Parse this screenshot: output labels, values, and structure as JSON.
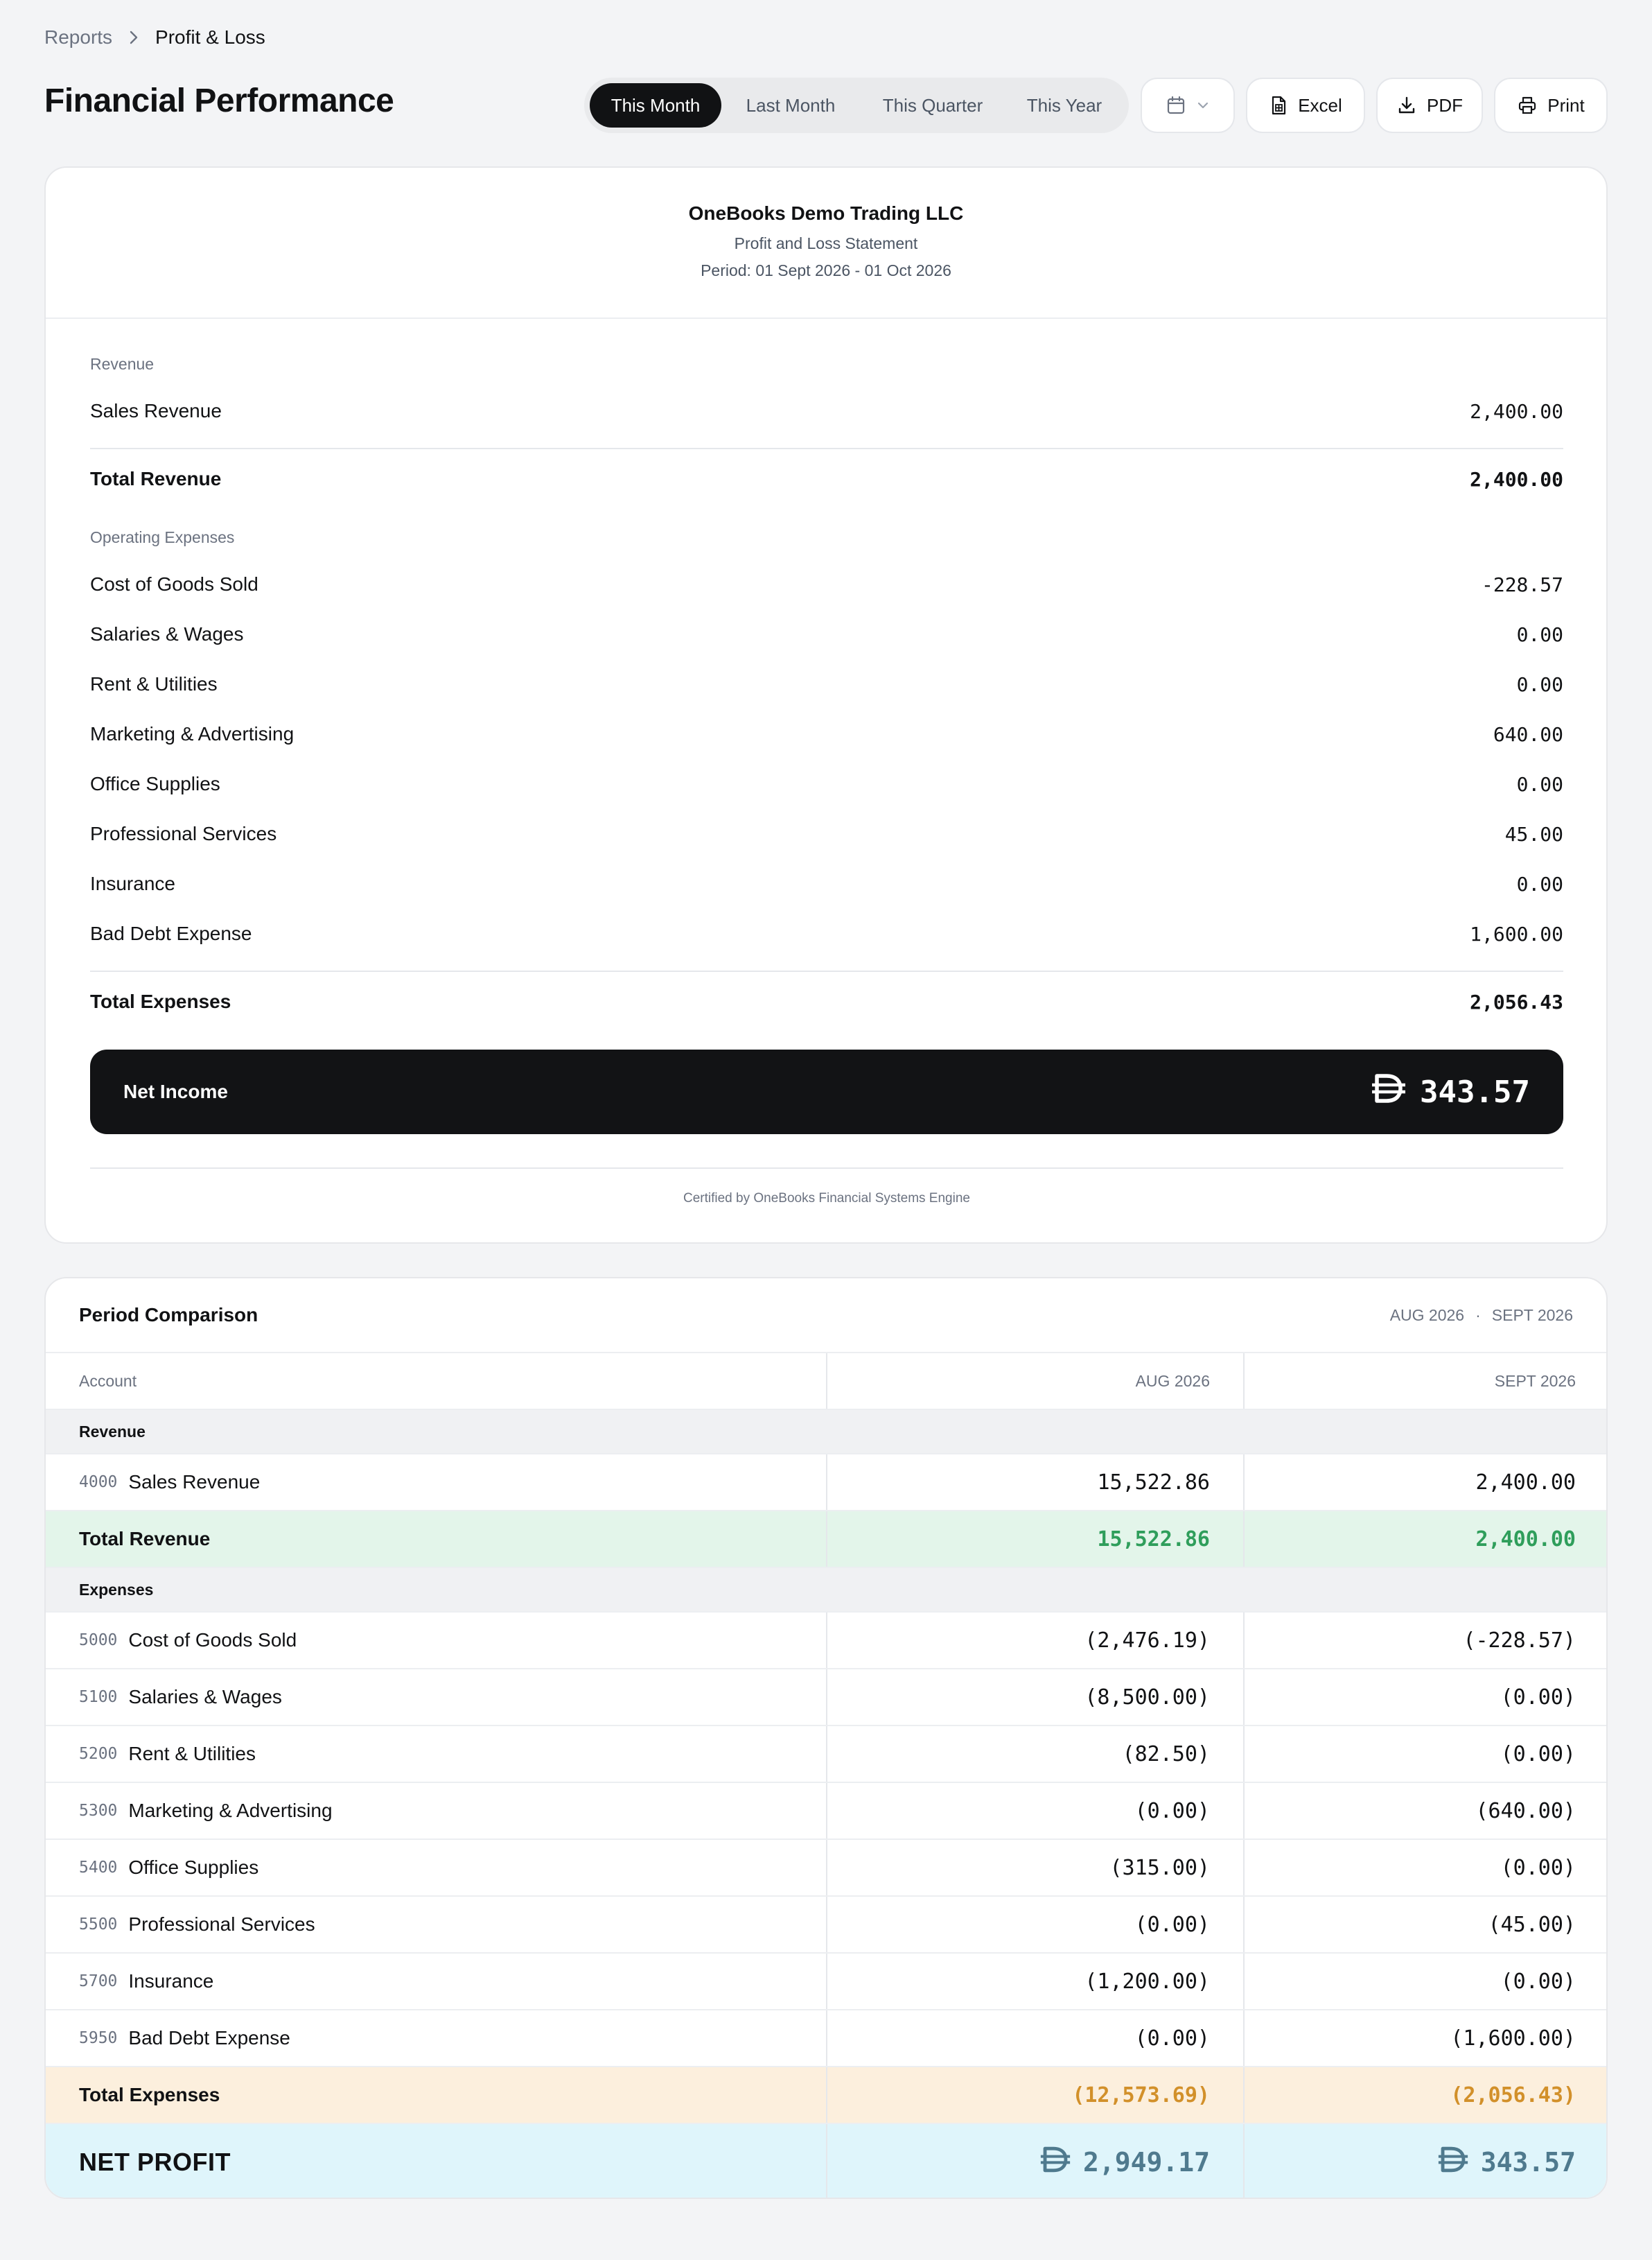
{
  "breadcrumb": {
    "parent": "Reports",
    "current": "Profit & Loss"
  },
  "page_title": "Financial Performance",
  "period_tabs": [
    "This Month",
    "Last Month",
    "This Quarter",
    "This Year"
  ],
  "active_tab": "This Month",
  "actions": {
    "excel": "Excel",
    "pdf": "PDF",
    "print": "Print"
  },
  "statement": {
    "company": "OneBooks Demo Trading LLC",
    "type": "Profit and Loss Statement",
    "period": "Period: 01 Sept 2026 - 01 Oct 2026",
    "revenue_label": "Revenue",
    "revenue_rows": [
      {
        "label": "Sales Revenue",
        "amount": "2,400.00"
      }
    ],
    "total_revenue": {
      "label": "Total Revenue",
      "amount": "2,400.00"
    },
    "expenses_label": "Operating Expenses",
    "expense_rows": [
      {
        "label": "Cost of Goods Sold",
        "amount": "-228.57"
      },
      {
        "label": "Salaries & Wages",
        "amount": "0.00"
      },
      {
        "label": "Rent & Utilities",
        "amount": "0.00"
      },
      {
        "label": "Marketing & Advertising",
        "amount": "640.00"
      },
      {
        "label": "Office Supplies",
        "amount": "0.00"
      },
      {
        "label": "Professional Services",
        "amount": "45.00"
      },
      {
        "label": "Insurance",
        "amount": "0.00"
      },
      {
        "label": "Bad Debt Expense",
        "amount": "1,600.00"
      }
    ],
    "total_expenses": {
      "label": "Total Expenses",
      "amount": "2,056.43"
    },
    "net_income": {
      "label": "Net Income",
      "amount": "343.57"
    },
    "certified": "Certified by OneBooks Financial Systems Engine"
  },
  "comparison": {
    "title": "Period Comparison",
    "period_a": "AUG 2026",
    "separator": "·",
    "period_b": "SEPT 2026",
    "col_account": "Account",
    "revenue_section": "Revenue",
    "revenue_rows": [
      {
        "code": "4000",
        "label": "Sales Revenue",
        "a": "15,522.86",
        "b": "2,400.00"
      }
    ],
    "total_revenue": {
      "label": "Total Revenue",
      "a": "15,522.86",
      "b": "2,400.00"
    },
    "expenses_section": "Expenses",
    "expense_rows": [
      {
        "code": "5000",
        "label": "Cost of Goods Sold",
        "a": "(2,476.19)",
        "b": "(-228.57)"
      },
      {
        "code": "5100",
        "label": "Salaries & Wages",
        "a": "(8,500.00)",
        "b": "(0.00)"
      },
      {
        "code": "5200",
        "label": "Rent & Utilities",
        "a": "(82.50)",
        "b": "(0.00)"
      },
      {
        "code": "5300",
        "label": "Marketing & Advertising",
        "a": "(0.00)",
        "b": "(640.00)"
      },
      {
        "code": "5400",
        "label": "Office Supplies",
        "a": "(315.00)",
        "b": "(0.00)"
      },
      {
        "code": "5500",
        "label": "Professional Services",
        "a": "(0.00)",
        "b": "(45.00)"
      },
      {
        "code": "5700",
        "label": "Insurance",
        "a": "(1,200.00)",
        "b": "(0.00)"
      },
      {
        "code": "5950",
        "label": "Bad Debt Expense",
        "a": "(0.00)",
        "b": "(1,600.00)"
      }
    ],
    "total_expenses": {
      "label": "Total Expenses",
      "a": "(12,573.69)",
      "b": "(2,056.43)"
    },
    "net_profit": {
      "label": "NET PROFIT",
      "a": "2,949.17",
      "b": "343.57"
    }
  },
  "icons": {
    "breadcrumb_sep": "chevron-right-icon",
    "date": "calendar-icon",
    "dropdown": "chevron-down-icon",
    "excel": "spreadsheet-file-icon",
    "pdf": "download-icon",
    "print": "printer-icon",
    "currency": "dirham-symbol-icon"
  },
  "colors": {
    "accent_dark": "#111214",
    "total_revenue_bg": "#e3f5ea",
    "total_revenue_text": "#2f9e5b",
    "total_expenses_bg": "#fcefdd",
    "total_expenses_text": "#d2902a",
    "net_profit_bg": "#dff5fb",
    "net_profit_text": "#4f7a8e"
  }
}
